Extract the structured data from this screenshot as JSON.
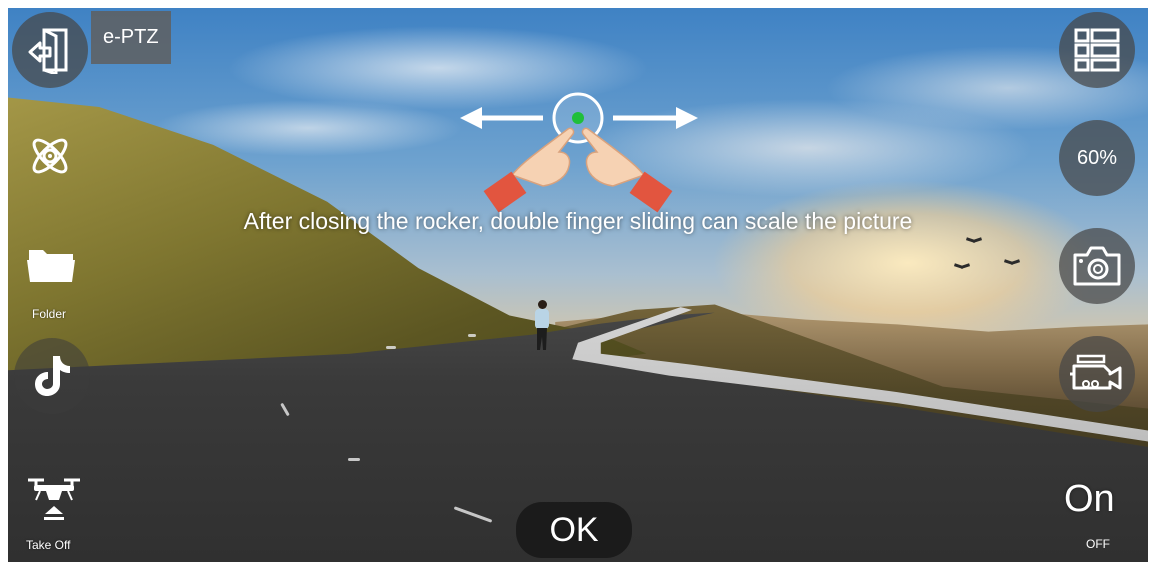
{
  "left_panel": {
    "eptz_label": "e-PTZ",
    "folder_label": "Folder",
    "takeoff_label": "Take Off"
  },
  "hint": {
    "text": "After closing the rocker, double finger sliding can scale the picture"
  },
  "right_panel": {
    "zoom_level": "60%",
    "toggle_on_label": "On",
    "toggle_off_label": "OFF"
  },
  "center": {
    "ok_label": "OK"
  },
  "icons": {
    "exit": "exit-door-icon",
    "rocker": "drone-rocker-icon",
    "folder": "folder-icon",
    "tiktok": "tiktok-icon",
    "takeoff": "drone-takeoff-icon",
    "menu": "list-menu-icon",
    "camera": "camera-icon",
    "video": "video-camera-icon",
    "gesture": "two-finger-pinch-icon"
  },
  "colors": {
    "gesture_dot": "#1fbf3a",
    "sleeve": "#e2553f",
    "button_bg": "#464646"
  }
}
